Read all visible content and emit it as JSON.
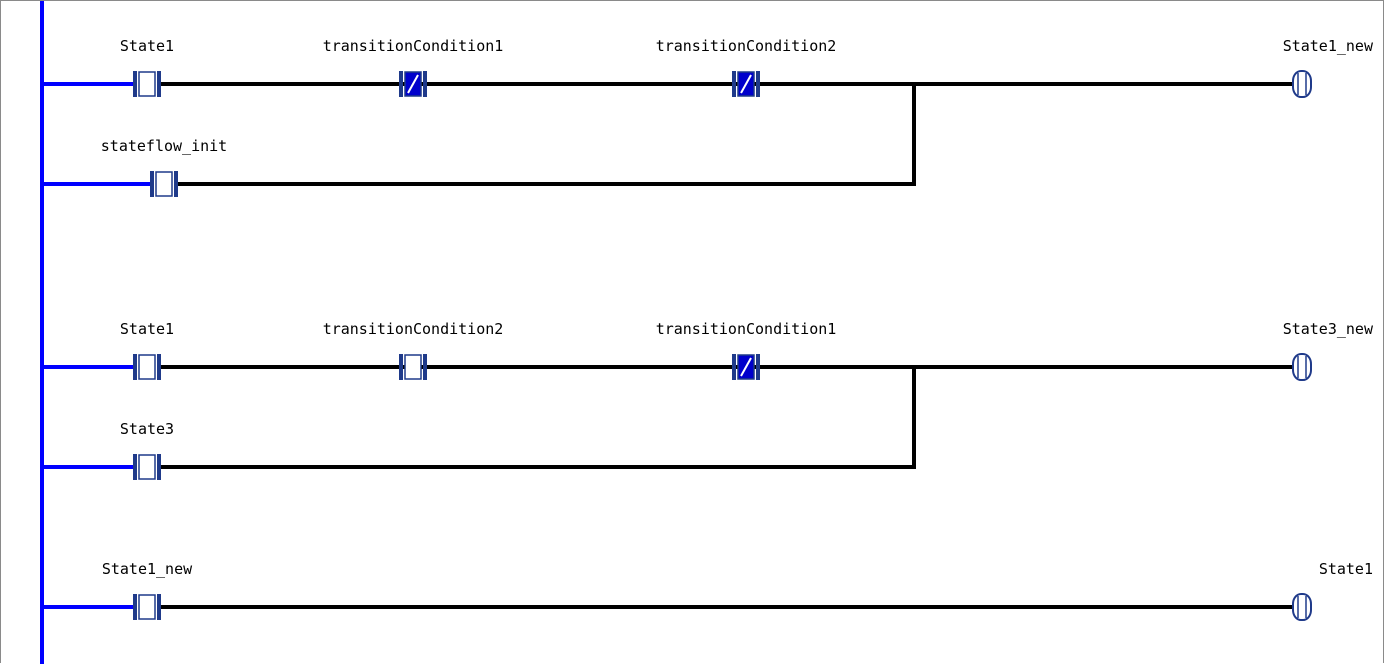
{
  "colors": {
    "power_rail": "#0000ff",
    "rung_wire": "#000000",
    "contact_outline": "#1f3a8a",
    "contact_fill": "#ffffff",
    "contact_fill_active": "#0000cc",
    "coil_outline": "#1f3a8a",
    "frame_border": "#8a8a8a"
  },
  "rungs": [
    {
      "branches": [
        {
          "contacts": [
            {
              "label": "State1",
              "type": "NO",
              "active": false
            },
            {
              "label": "transitionCondition1",
              "type": "NC",
              "active": true
            },
            {
              "label": "transitionCondition2",
              "type": "NC",
              "active": true
            }
          ]
        },
        {
          "contacts": [
            {
              "label": "stateflow_init",
              "type": "NO",
              "active": false
            }
          ]
        }
      ],
      "coil": {
        "label": "State1_new"
      }
    },
    {
      "branches": [
        {
          "contacts": [
            {
              "label": "State1",
              "type": "NO",
              "active": false
            },
            {
              "label": "transitionCondition2",
              "type": "NO",
              "active": false
            },
            {
              "label": "transitionCondition1",
              "type": "NC",
              "active": true
            }
          ]
        },
        {
          "contacts": [
            {
              "label": "State3",
              "type": "NO",
              "active": false
            }
          ]
        }
      ],
      "coil": {
        "label": "State3_new"
      }
    },
    {
      "branches": [
        {
          "contacts": [
            {
              "label": "State1_new",
              "type": "NO",
              "active": false
            }
          ]
        }
      ],
      "coil": {
        "label": "State1"
      }
    }
  ]
}
